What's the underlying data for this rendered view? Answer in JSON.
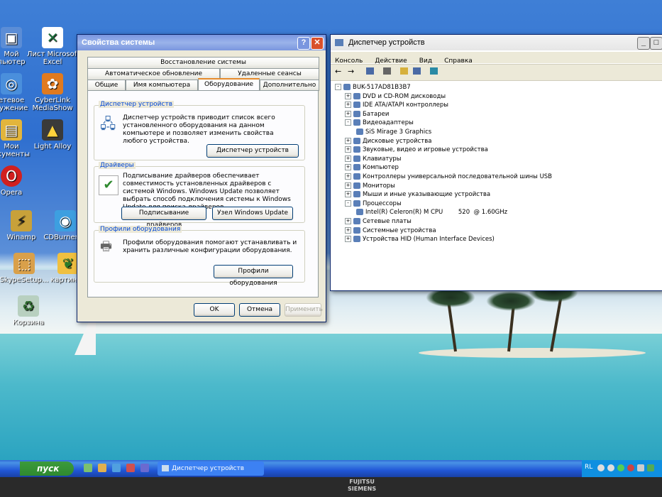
{
  "desktop_icons": [
    {
      "label": "Мой\nпьютер",
      "icon": "my-computer-icon"
    },
    {
      "label": "Лист Microsoft\nExcel",
      "icon": "excel-icon"
    },
    {
      "label": "етевое\nружение",
      "icon": "network-icon"
    },
    {
      "label": "CyberLink\nMediaShow",
      "icon": "mediashow-icon"
    },
    {
      "label": "Мои\nокументы",
      "icon": "my-documents-icon"
    },
    {
      "label": "Light Alloy",
      "icon": "light-alloy-icon"
    },
    {
      "label": "Opera",
      "icon": "opera-icon"
    },
    {
      "label": "Winamp",
      "icon": "winamp-icon"
    },
    {
      "label": "CDBurnerXP",
      "icon": "cdburner-icon"
    },
    {
      "label": "SkypeSetup...",
      "icon": "skype-icon"
    },
    {
      "label": "картинки",
      "icon": "pictures-icon"
    },
    {
      "label": "Корзина",
      "icon": "recycle-bin-icon"
    }
  ],
  "sysprops": {
    "title": "Свойства системы",
    "tabs_row1": [
      "Восстановление системы"
    ],
    "tabs_row2": [
      "Автоматическое обновление",
      "Удаленные сеансы"
    ],
    "tabs_row3": [
      "Общие",
      "Имя компьютера",
      "Оборудование",
      "Дополнительно"
    ],
    "devmgr_group": {
      "legend": "Диспетчер устройств",
      "text": "Диспетчер устройств приводит список всего установленного оборудования на данном компьютере и позволяет изменить свойства любого устройства.",
      "button": "Диспетчер устройств"
    },
    "drivers_group": {
      "legend": "Драйверы",
      "text": "Подписывание драйверов обеспечивает совместимость установленных драйверов с системой Windows. Windows Update позволяет выбрать способ подключения системы к Windows Update для поиска драйверов.",
      "button1": "Подписывание драйверов",
      "button2": "Узел Windows Update"
    },
    "profiles_group": {
      "legend": "Профили оборудования",
      "text": "Профили оборудования помогают устанавливать и хранить различные конфигурации оборудования.",
      "button": "Профили оборудования"
    },
    "ok": "OK",
    "cancel": "Отмена",
    "apply": "Применить"
  },
  "devmgr": {
    "title": "Диспетчер устройств",
    "menu": [
      "Консоль",
      "Действие",
      "Вид",
      "Справка"
    ],
    "root": "BUK-517AD81B3B7",
    "tree": [
      {
        "label": "DVD и CD-ROM дисководы",
        "level": 1,
        "exp": "+"
      },
      {
        "label": "IDE ATA/ATAPI контроллеры",
        "level": 1,
        "exp": "+"
      },
      {
        "label": "Батареи",
        "level": 1,
        "exp": "+"
      },
      {
        "label": "Видеоадаптеры",
        "level": 1,
        "exp": "-"
      },
      {
        "label": "SiS Mirage 3 Graphics",
        "level": 2,
        "exp": ""
      },
      {
        "label": "Дисковые устройства",
        "level": 1,
        "exp": "+"
      },
      {
        "label": "Звуковые, видео и игровые устройства",
        "level": 1,
        "exp": "+"
      },
      {
        "label": "Клавиатуры",
        "level": 1,
        "exp": "+"
      },
      {
        "label": "Компьютер",
        "level": 1,
        "exp": "+"
      },
      {
        "label": "Контроллеры универсальной последовательной шины USB",
        "level": 1,
        "exp": "+"
      },
      {
        "label": "Мониторы",
        "level": 1,
        "exp": "+"
      },
      {
        "label": "Мыши и иные указывающие устройства",
        "level": 1,
        "exp": "+"
      },
      {
        "label": "Процессоры",
        "level": 1,
        "exp": "-"
      },
      {
        "label": "Intel(R) Celeron(R) M CPU        520  @ 1.60GHz",
        "level": 2,
        "exp": ""
      },
      {
        "label": "Сетевые платы",
        "level": 1,
        "exp": "+"
      },
      {
        "label": "Системные устройства",
        "level": 1,
        "exp": "+"
      },
      {
        "label": "Устройства HID (Human Interface Devices)",
        "level": 1,
        "exp": "+"
      }
    ]
  },
  "taskbar": {
    "start": "пуск",
    "task": "Диспетчер устройств",
    "lang": "RL"
  },
  "bezel": {
    "brand": "FUJITSU\nSIEMENS"
  },
  "colors": {
    "titlebar": "#0a5de0",
    "window": "#ece9d8",
    "legend": "#0046d5"
  }
}
